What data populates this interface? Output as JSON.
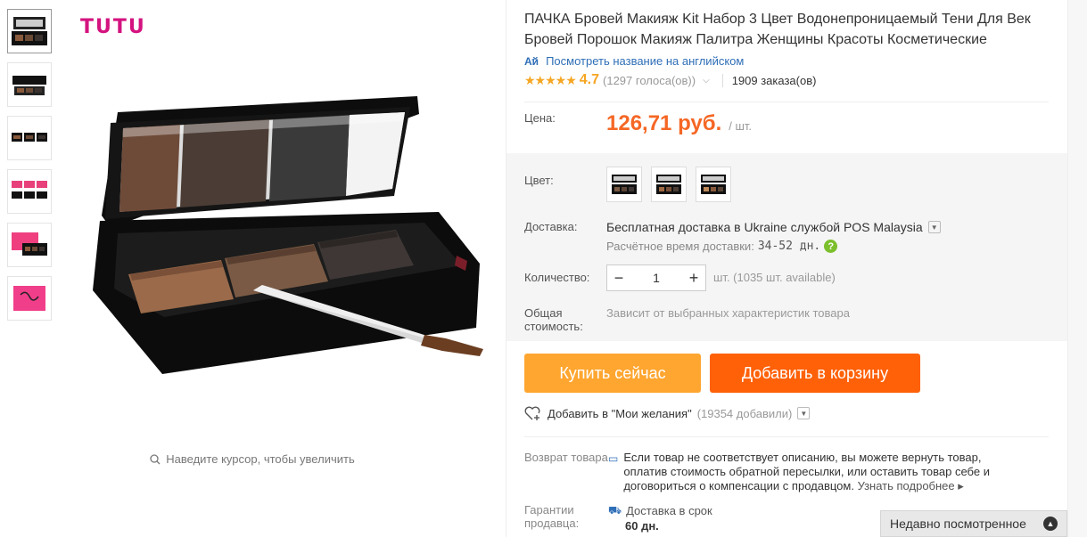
{
  "thumbnails": [
    {
      "alt": "palette-open"
    },
    {
      "alt": "palette-closed"
    },
    {
      "alt": "palette-set"
    },
    {
      "alt": "palette-pink-set"
    },
    {
      "alt": "palette-pink-box"
    },
    {
      "alt": "pink-card"
    }
  ],
  "gallery": {
    "brand": "TUTU",
    "zoom_hint": "Наведите курсор, чтобы увеличить"
  },
  "product": {
    "title": "ПАЧКА Бровей Макияж Kit Набор 3 Цвет Водонепроницаемый Тени Для Век Бровей Порошок Макияж Палитра Женщины Красоты Косметические",
    "translate_link": "Посмотреть название на английском",
    "rating_stars": "★★★★★",
    "rating_value": "4.7",
    "votes": "(1297 голоса(ов))",
    "orders": "1909 заказа(ов)"
  },
  "price": {
    "label": "Цена:",
    "value": "126,71 руб.",
    "unit": "/ шт."
  },
  "color": {
    "label": "Цвет:"
  },
  "shipping": {
    "label": "Доставка:",
    "method": "Бесплатная доставка в Ukraine службой POS Malaysia",
    "estimate_label": "Расчётное время доставки:",
    "estimate_value": "34-52 дн.",
    "help": "?"
  },
  "quantity": {
    "label": "Количество:",
    "value": "1",
    "minus": "−",
    "plus": "+",
    "note": "шт. (1035 шт. available)"
  },
  "total": {
    "label": "Общая стоимость:",
    "note": "Зависит от выбранных характеристик товара"
  },
  "buttons": {
    "buy_now": "Купить сейчас",
    "add_to_cart": "Добавить в корзину"
  },
  "wishlist": {
    "label": "Добавить в \"Мои желания\"",
    "count": "(19354 добавили)"
  },
  "returns": {
    "label": "Возврат товара",
    "text": "Если товар не соответствует описанию, вы можете вернуть товар, оплатив стоимость обратной пересылки, или оставить товар себе и договориться о компенсации с продавцом.",
    "more": "Узнать подробнее"
  },
  "guarantee": {
    "label": "Гарантии продавца:",
    "title": "Доставка в срок",
    "value": "60 дн."
  },
  "recently_viewed": {
    "label": "Недавно посмотренное"
  },
  "colors": {
    "price": "#f56725",
    "buy_now": "#ffa630",
    "add_to_cart": "#ff6109",
    "link": "#2f6fb7",
    "star": "#f5a623"
  }
}
